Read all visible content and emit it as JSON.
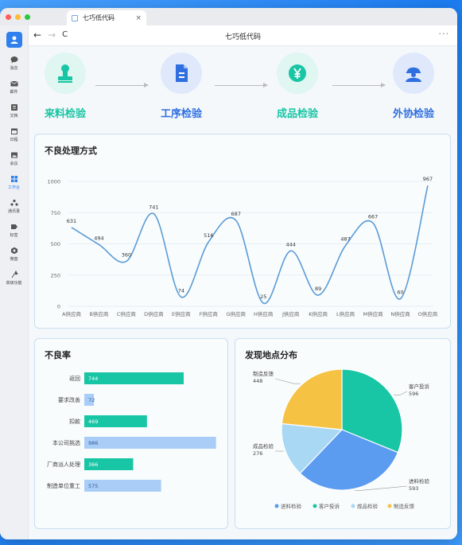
{
  "window": {
    "tab_title": "七巧低代码",
    "page_title": "七巧低代码",
    "traffic_colors": [
      "#ff5f57",
      "#febc2e",
      "#28c840"
    ]
  },
  "toolbar": {
    "back": "←",
    "forward": "→",
    "reload": "C",
    "more": "···"
  },
  "sidebar": {
    "items": [
      {
        "label": "消息",
        "icon": "chat-icon"
      },
      {
        "label": "邮件",
        "icon": "mail-icon"
      },
      {
        "label": "文档",
        "icon": "doc-icon"
      },
      {
        "label": "日程",
        "icon": "calendar-icon"
      },
      {
        "label": "会议",
        "icon": "image-icon"
      },
      {
        "label": "工作台",
        "icon": "grid-icon",
        "active": true
      },
      {
        "label": "通讯录",
        "icon": "contacts-icon"
      },
      {
        "label": "标签",
        "icon": "tag-icon"
      },
      {
        "label": "微盘",
        "icon": "drive-icon"
      },
      {
        "label": "高级功能",
        "icon": "sparkle-icon"
      }
    ]
  },
  "steps": [
    {
      "label": "来料检验",
      "icon": "stamp-icon",
      "color": "#18c5a4",
      "bg": "#dff6f1"
    },
    {
      "label": "工序检验",
      "icon": "document-icon",
      "color": "#2f6fe0",
      "bg": "#dfe9fb"
    },
    {
      "label": "成品检验",
      "icon": "yen-icon",
      "color": "#18c5a4",
      "bg": "#dff6f1"
    },
    {
      "label": "外协检验",
      "icon": "worker-icon",
      "color": "#2f6fe0",
      "bg": "#dfe9fb"
    }
  ],
  "line_card": {
    "title": "不良处理方式"
  },
  "bar_card": {
    "title": "不良率"
  },
  "pie_card": {
    "title": "发现地点分布"
  },
  "chart_data": [
    {
      "type": "line",
      "title": "不良处理方式",
      "categories": [
        "A供应商",
        "B供应商",
        "C供应商",
        "D供应商",
        "E供应商",
        "F供应商",
        "G供应商",
        "H供应商",
        "J供应商",
        "K供应商",
        "L供应商",
        "M供应商",
        "N供应商",
        "O供应商"
      ],
      "values": [
        631,
        494,
        360,
        741,
        74,
        516,
        687,
        25,
        444,
        89,
        487,
        667,
        60,
        967
      ],
      "ylim": [
        0,
        1000
      ],
      "yticks": [
        0,
        250,
        500,
        750,
        1000
      ],
      "grid": true,
      "color": "#5b9bd5"
    },
    {
      "type": "bar",
      "orientation": "horizontal",
      "title": "不良率",
      "categories": [
        "返回",
        "要求改善",
        "扣款",
        "本公司挑选",
        "厂商派人处理",
        "制造单位重工"
      ],
      "values": [
        744,
        72,
        469,
        986,
        366,
        575
      ],
      "colors": [
        "#18c5a4",
        "#a9cdf7",
        "#18c5a4",
        "#a9cdf7",
        "#18c5a4",
        "#a9cdf7"
      ],
      "xlim": [
        0,
        1000
      ]
    },
    {
      "type": "pie",
      "title": "发现地点分布",
      "slices": [
        {
          "name": "客户投诉",
          "value": 596,
          "color": "#18c5a4"
        },
        {
          "name": "进料检验",
          "value": 593,
          "color": "#5b9bf0"
        },
        {
          "name": "成品检验",
          "value": 276,
          "color": "#a9d8f5"
        },
        {
          "name": "制造反馈",
          "value": 448,
          "color": "#f6c244"
        }
      ],
      "legend": [
        "进料检验",
        "客户投诉",
        "成品检验",
        "制造反馈"
      ],
      "legend_position": "bottom"
    }
  ]
}
